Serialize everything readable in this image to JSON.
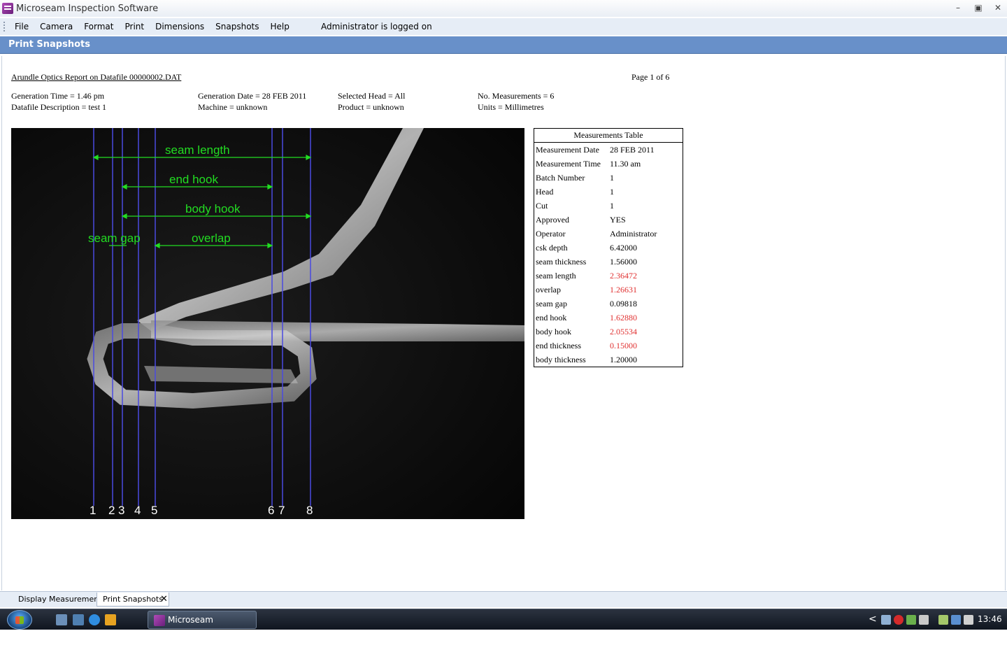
{
  "window": {
    "title": "Microseam Inspection Software",
    "minimize": "–",
    "maximize": "▣",
    "close": "✕"
  },
  "menu": {
    "items": [
      {
        "label": "File"
      },
      {
        "label": "Camera"
      },
      {
        "label": "Format"
      },
      {
        "label": "Print"
      },
      {
        "label": "Dimensions"
      },
      {
        "label": "Snapshots"
      },
      {
        "label": "Help"
      }
    ],
    "status": "Administrator is logged on"
  },
  "panel": {
    "title": "Print Snapshots"
  },
  "report": {
    "title": "Arundle Optics Report on Datafile 00000002.DAT",
    "page": "Page 1 of 6",
    "info": {
      "generation_time": "Generation Time = 1.46 pm",
      "datafile_description": "Datafile Description = test 1",
      "generation_date": "Generation Date = 28 FEB 2011",
      "machine": "Machine = unknown",
      "selected_head": "Selected Head = All",
      "product": "Product = unknown",
      "no_measurements": "No. Measurements = 6",
      "units": "Units = Millimetres"
    }
  },
  "snapshot": {
    "labels": {
      "seam_length": "seam length",
      "end_hook": "end hook",
      "body_hook": "body hook",
      "seam_gap": "seam gap",
      "overlap": "overlap"
    },
    "line_numbers": [
      "1",
      "2",
      "3",
      "4",
      "5",
      "6",
      "7",
      "8"
    ],
    "annotation_color": "#22dd22",
    "line_color": "#4a4ae0"
  },
  "measurements_table": {
    "title": "Measurements Table",
    "rows": [
      {
        "label": "Measurement Date",
        "value": "28 FEB 2011",
        "color": "#000000"
      },
      {
        "label": "Measurement Time",
        "value": "11.30 am",
        "color": "#000000"
      },
      {
        "label": "Batch Number",
        "value": "1",
        "color": "#000000"
      },
      {
        "label": "Head",
        "value": "1",
        "color": "#000000"
      },
      {
        "label": "Cut",
        "value": "1",
        "color": "#000000"
      },
      {
        "label": "Approved",
        "value": "YES",
        "color": "#000000"
      },
      {
        "label": "Operator",
        "value": "Administrator",
        "color": "#000000"
      },
      {
        "label": "csk  depth",
        "value": "6.42000",
        "color": "#000000"
      },
      {
        "label": "seam thickness",
        "value": "1.56000",
        "color": "#000000"
      },
      {
        "label": "seam length",
        "value": "2.36472",
        "color": "#e03030"
      },
      {
        "label": "overlap",
        "value": "1.26631",
        "color": "#e03030"
      },
      {
        "label": "seam gap",
        "value": "0.09818",
        "color": "#000000"
      },
      {
        "label": "end hook",
        "value": "1.62880",
        "color": "#e03030"
      },
      {
        "label": "body hook",
        "value": "2.05534",
        "color": "#e03030"
      },
      {
        "label": "end thickness",
        "value": "0.15000",
        "color": "#e03030"
      },
      {
        "label": "body thickness",
        "value": "1.20000",
        "color": "#000000"
      }
    ]
  },
  "tabs": {
    "display": "Display Measurements",
    "print": "Print Snapshots",
    "close": "✕"
  },
  "taskbar": {
    "task_label": "Microseam Inspecti...",
    "clock": "13:46",
    "tray_chevron": "<"
  }
}
